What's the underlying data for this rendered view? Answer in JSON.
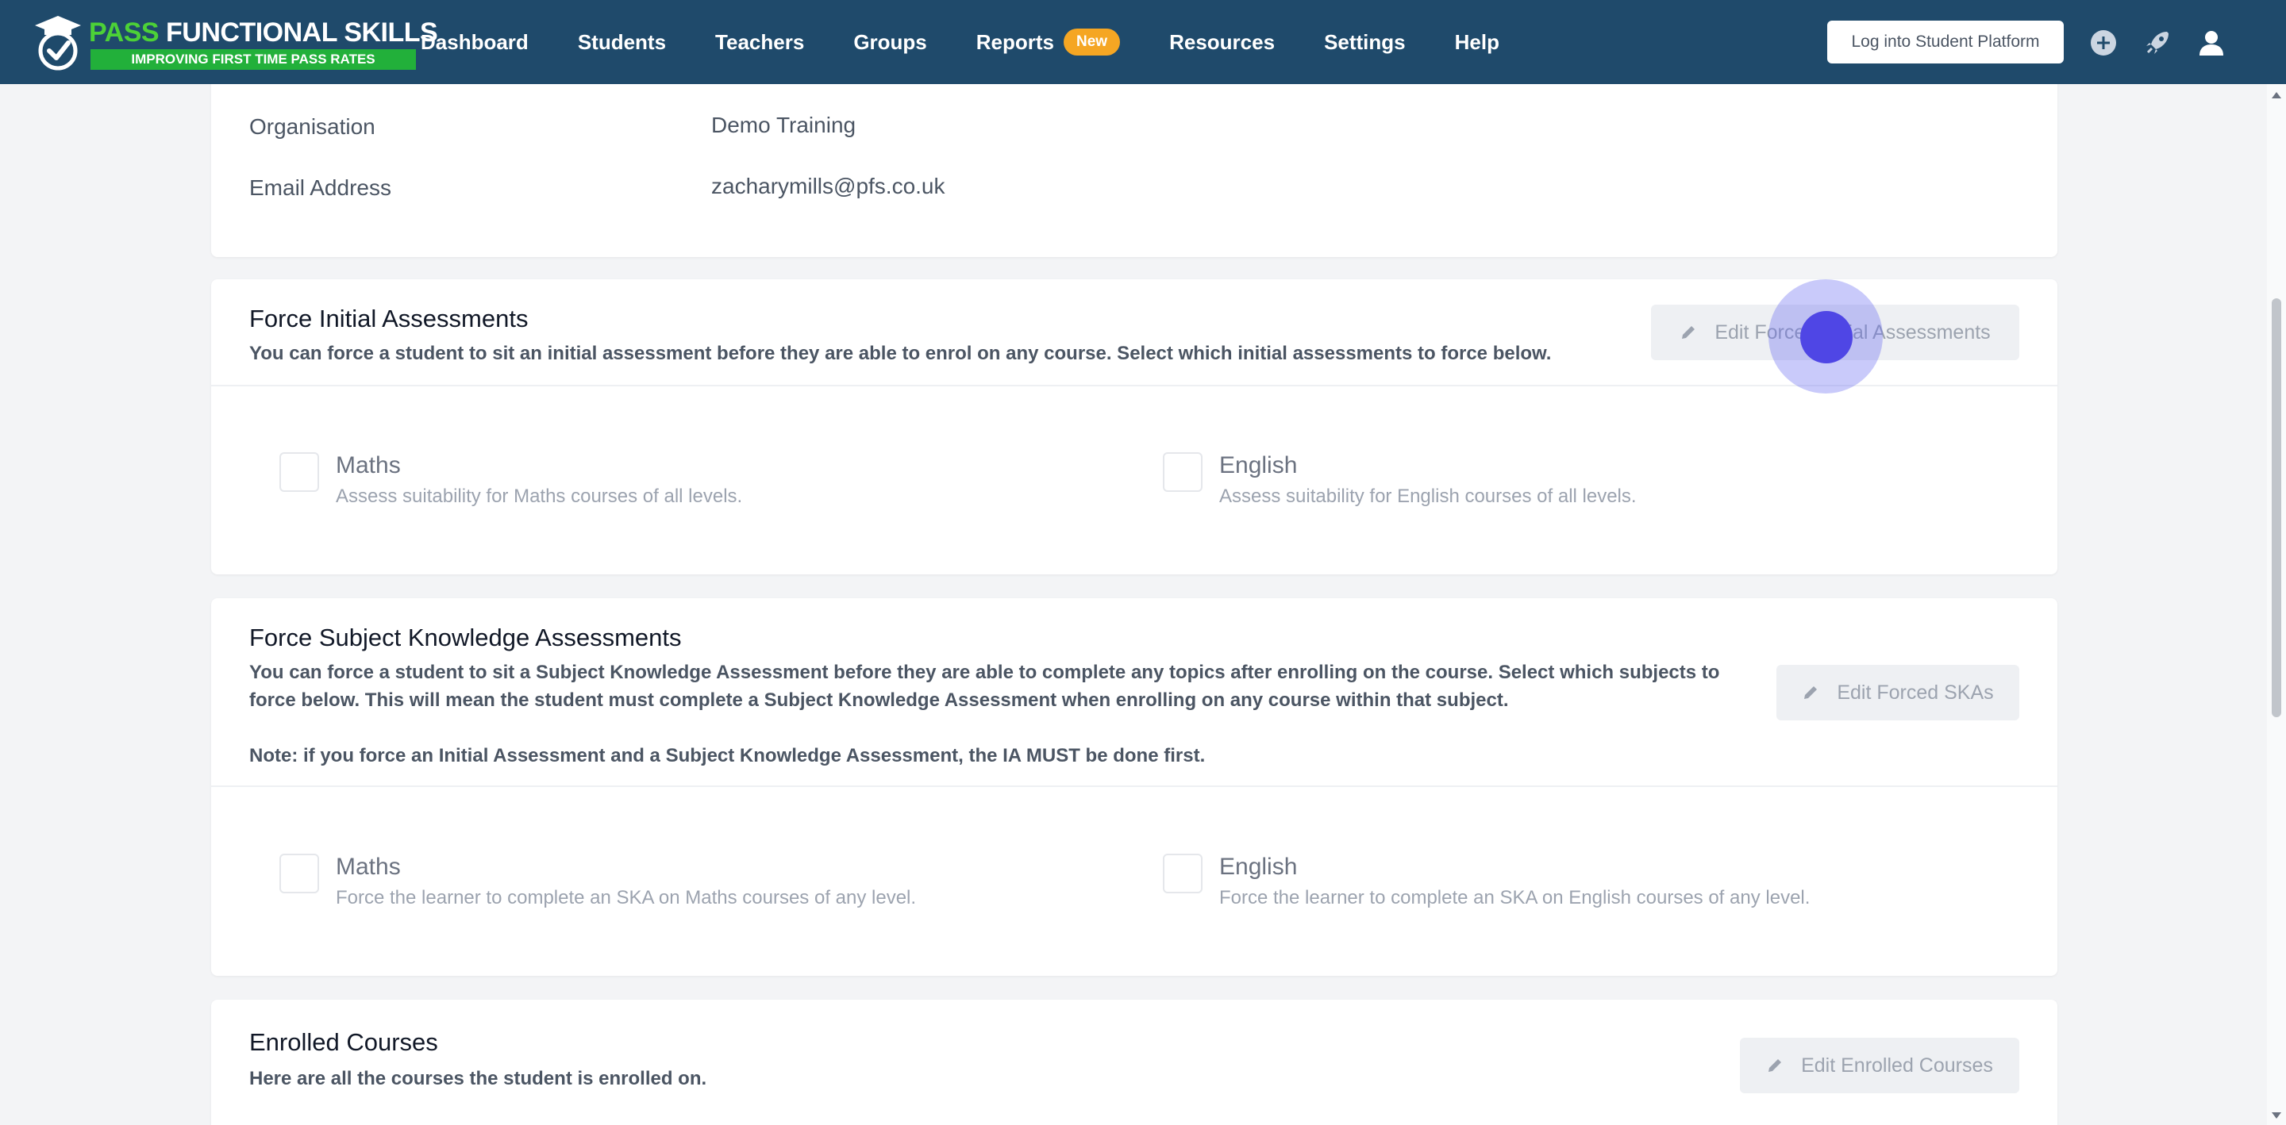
{
  "brand": {
    "title_pass": "PASS",
    "title_rest": " FUNCTIONAL SKILLS",
    "tagline": "IMPROVING FIRST TIME PASS RATES",
    "logo_icon": "graduation-check-icon"
  },
  "nav": {
    "items": [
      {
        "label": "Dashboard"
      },
      {
        "label": "Students"
      },
      {
        "label": "Teachers"
      },
      {
        "label": "Groups"
      },
      {
        "label": "Reports",
        "badge": "New"
      },
      {
        "label": "Resources"
      },
      {
        "label": "Settings"
      },
      {
        "label": "Help"
      }
    ],
    "login_button": "Log into Student Platform",
    "icons": [
      "plus-circle-icon",
      "rocket-icon",
      "user-icon"
    ]
  },
  "student_info": {
    "organisation_label": "Organisation",
    "organisation_value": "Demo Training",
    "email_label": "Email Address",
    "email_value": "zacharymills@pfs.co.uk"
  },
  "force_initial": {
    "title": "Force Initial Assessments",
    "description": "You can force a student to sit an initial assessment before they are able to enrol on any course. Select which initial assessments to force below.",
    "edit_button": "Edit Forced Initial Assessments",
    "options": [
      {
        "title": "Maths",
        "desc": "Assess suitability for Maths courses of all levels."
      },
      {
        "title": "English",
        "desc": "Assess suitability for English courses of all levels."
      }
    ]
  },
  "force_ska": {
    "title": "Force Subject Knowledge Assessments",
    "description_line1": "You can force a student to sit a Subject Knowledge Assessment before they are able to complete any topics after enrolling on the course. Select which subjects to",
    "description_line2": "force below. This will mean the student must complete a Subject Knowledge Assessment when enrolling on any course within that subject.",
    "note": "Note: if you force an Initial Assessment and a Subject Knowledge Assessment, the IA MUST be done first.",
    "edit_button": "Edit Forced SKAs",
    "options": [
      {
        "title": "Maths",
        "desc": "Force the learner to complete an SKA on Maths courses of any level."
      },
      {
        "title": "English",
        "desc": "Force the learner to complete an SKA on English courses of any level."
      }
    ]
  },
  "enrolled": {
    "title": "Enrolled Courses",
    "description": "Here are all the courses the student is enrolled on.",
    "edit_button": "Edit Enrolled Courses"
  },
  "colors": {
    "navbar": "#1f4a6b",
    "brand_green": "#22b03a",
    "badge": "#f5a623",
    "click_indicator": "#4f46e5"
  }
}
